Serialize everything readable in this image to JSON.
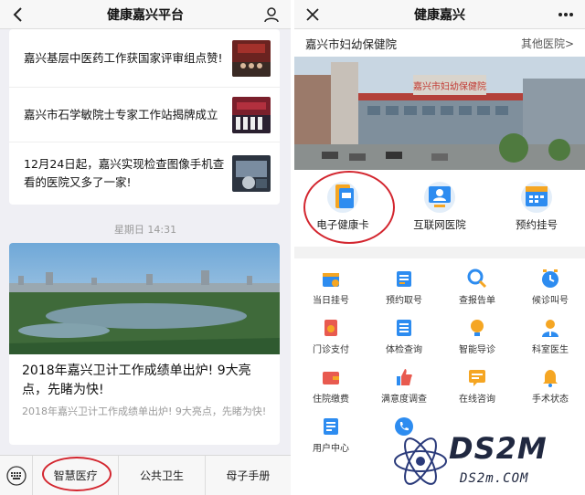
{
  "left": {
    "nav": {
      "title": "健康嘉兴平台",
      "back_icon": "chevron-left-icon",
      "profile_icon": "person-icon"
    },
    "news": [
      {
        "title": "嘉兴基层中医药工作获国家评审组点赞!"
      },
      {
        "title": "嘉兴市石学敏院士专家工作站揭牌成立"
      },
      {
        "title": "12月24日起，嘉兴实现检查图像手机查看的医院又多了一家!"
      }
    ],
    "timestamp": "星期日 14:31",
    "article": {
      "title": "2018年嘉兴卫计工作成绩单出炉! 9大亮点，先睹为快!",
      "desc": "2018年嘉兴卫计工作成绩单出炉! 9大亮点，先睹为快!"
    },
    "tabs": [
      {
        "label": "智慧医疗"
      },
      {
        "label": "公共卫生"
      },
      {
        "label": "母子手册"
      }
    ],
    "keyboard_icon": "keyboard-icon"
  },
  "right": {
    "nav": {
      "title": "健康嘉兴",
      "close_icon": "close-icon",
      "more_icon": "more-icon"
    },
    "hospital": {
      "name": "嘉兴市妇幼保健院",
      "other": "其他医院>"
    },
    "banner_sign": "嘉兴市妇幼保健院",
    "quick": [
      {
        "label": "电子健康卡",
        "icon": "health-card-icon"
      },
      {
        "label": "互联网医院",
        "icon": "internet-hospital-icon"
      },
      {
        "label": "预约挂号",
        "icon": "appointment-icon"
      }
    ],
    "grid": [
      {
        "label": "当日挂号",
        "icon": "same-day-register-icon"
      },
      {
        "label": "预约取号",
        "icon": "appointment-number-icon"
      },
      {
        "label": "查报告单",
        "icon": "search-report-icon"
      },
      {
        "label": "候诊叫号",
        "icon": "queue-clock-icon"
      },
      {
        "label": "门诊支付",
        "icon": "payment-icon"
      },
      {
        "label": "体检查询",
        "icon": "checkup-icon"
      },
      {
        "label": "智能导诊",
        "icon": "smart-guide-icon"
      },
      {
        "label": "科室医生",
        "icon": "doctor-icon"
      },
      {
        "label": "住院缴费",
        "icon": "wallet-icon"
      },
      {
        "label": "满意度调查",
        "icon": "thumbs-up-icon"
      },
      {
        "label": "在线咨询",
        "icon": "consult-icon"
      },
      {
        "label": "手术状态",
        "icon": "bell-icon"
      },
      {
        "label": "用户中心",
        "icon": "user-center-icon"
      },
      {
        "label": "",
        "icon": "phone-icon"
      }
    ]
  },
  "watermark": {
    "text": "DS2M",
    "sub": "DS2m.COM"
  },
  "colors": {
    "accent": "#2d8cf0",
    "highlight_circle": "#d3262f"
  }
}
